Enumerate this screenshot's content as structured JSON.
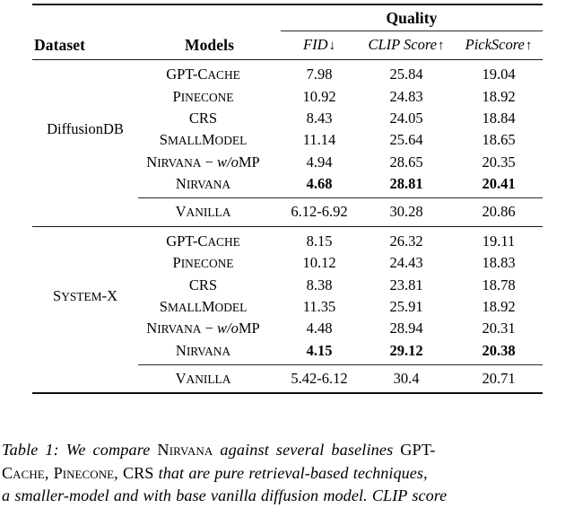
{
  "table": {
    "number_label": "Table 1:",
    "header": {
      "group_label": "Quality",
      "dataset_label": "Dataset",
      "models_label": "Models",
      "metrics": [
        {
          "name": "FID",
          "arrow": "↓"
        },
        {
          "name": "CLIP Score",
          "arrow": "↑"
        },
        {
          "name": "PickScore",
          "arrow": "↑"
        }
      ]
    },
    "blocks": [
      {
        "dataset": "DiffusionDB",
        "rows": [
          {
            "model": "GPT-Cache",
            "model_style": "gpt-cache",
            "fid": "7.98",
            "clip": "25.84",
            "pick": "19.04",
            "bold": false
          },
          {
            "model": "Pinecone",
            "model_style": "smallcaps",
            "fid": "10.92",
            "clip": "24.83",
            "pick": "18.92",
            "bold": false
          },
          {
            "model": "CRS",
            "model_style": "plain",
            "fid": "8.43",
            "clip": "24.05",
            "pick": "18.84",
            "bold": false
          },
          {
            "model": "SmallModel",
            "model_style": "smallcaps",
            "fid": "11.14",
            "clip": "25.64",
            "pick": "18.65",
            "bold": false
          },
          {
            "model": "Nirvana − w/oMP",
            "model_style": "nirvana-womp",
            "fid": "4.94",
            "clip": "28.65",
            "pick": "20.35",
            "bold": false
          },
          {
            "model": "Nirvana",
            "model_style": "smallcaps",
            "fid": "4.68",
            "clip": "28.81",
            "pick": "20.41",
            "bold": true
          }
        ],
        "baseline": {
          "model": "Vanilla",
          "model_style": "smallcaps",
          "fid": "6.12-6.92",
          "clip": "30.28",
          "pick": "20.86",
          "bold": false
        }
      },
      {
        "dataset": "System-X",
        "dataset_style": "smallcaps",
        "rows": [
          {
            "model": "GPT-Cache",
            "model_style": "gpt-cache",
            "fid": "8.15",
            "clip": "26.32",
            "pick": "19.11",
            "bold": false
          },
          {
            "model": "Pinecone",
            "model_style": "smallcaps",
            "fid": "10.12",
            "clip": "24.43",
            "pick": "18.83",
            "bold": false
          },
          {
            "model": "CRS",
            "model_style": "plain",
            "fid": "8.38",
            "clip": "23.81",
            "pick": "18.78",
            "bold": false
          },
          {
            "model": "SmallModel",
            "model_style": "smallcaps",
            "fid": "11.35",
            "clip": "25.91",
            "pick": "18.92",
            "bold": false
          },
          {
            "model": "Nirvana − w/oMP",
            "model_style": "nirvana-womp",
            "fid": "4.48",
            "clip": "28.94",
            "pick": "20.31",
            "bold": false
          },
          {
            "model": "Nirvana",
            "model_style": "smallcaps",
            "fid": "4.15",
            "clip": "29.12",
            "pick": "20.38",
            "bold": true
          }
        ],
        "baseline": {
          "model": "Vanilla",
          "model_style": "smallcaps",
          "fid": "5.42-6.12",
          "clip": "30.4",
          "pick": "20.71",
          "bold": false
        }
      }
    ]
  },
  "caption": {
    "line1_a": "Table 1: We compare ",
    "line1_sc": "Nirvana",
    "line1_b": " against several baselines ",
    "line1_roman": "GPT-",
    "line2_sc1": "Cache",
    "line2_a": ", ",
    "line2_sc2": "Pinecone",
    "line2_b": ", ",
    "line2_roman": "CRS",
    "line2_c": " that are pure retrieval-based techniques,",
    "line3": "a smaller-model and with base vanilla diffusion model. CLIP score"
  }
}
